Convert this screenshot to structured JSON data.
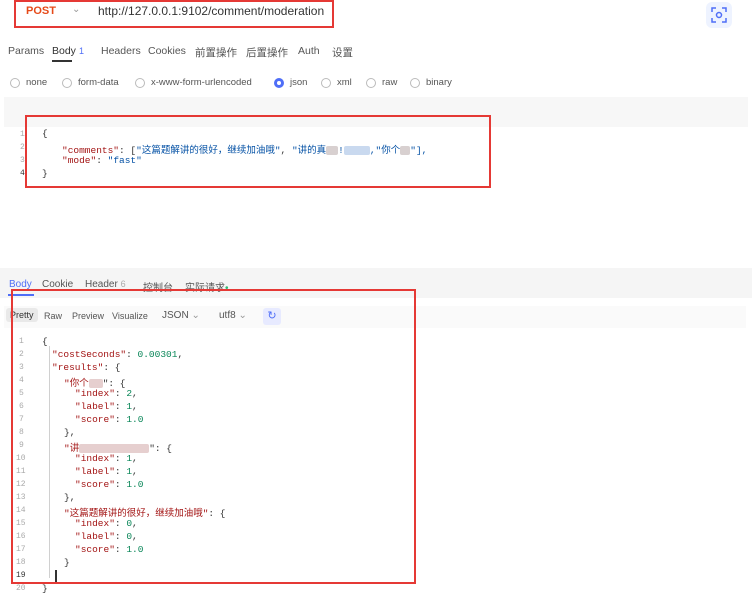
{
  "request": {
    "method": "POST",
    "url": "http://127.0.0.1:9102/comment/moderation"
  },
  "icons": {
    "scan": "scan-icon",
    "chevron": "chevron-down-icon",
    "wrap": "wrap-icon"
  },
  "colors": {
    "accent": "#4f6ef7",
    "method": "#e64a19",
    "highlight_border": "#e53935"
  },
  "request_tabs": [
    {
      "label": "Params"
    },
    {
      "label": "Body",
      "badge": "1"
    },
    {
      "label": "Headers"
    },
    {
      "label": "Cookies"
    },
    {
      "label": "前置操作"
    },
    {
      "label": "后置操作"
    },
    {
      "label": "Auth"
    },
    {
      "label": "设置"
    }
  ],
  "body_types": {
    "options": [
      "none",
      "form-data",
      "x-www-form-urlencoded",
      "json",
      "xml",
      "raw",
      "binary"
    ],
    "selected": "json"
  },
  "request_editor": {
    "line_numbers": [
      "1",
      "2",
      "3",
      "4"
    ],
    "line1": "{",
    "line2_key": "\"comments\"",
    "line2_colon": ": [",
    "line2_str1": "\"这篇题解讲的很好，继续加油哦\"",
    "line2_sep": ", ",
    "line2_str2": "\"讲的真",
    "line2_str2b": "!",
    "line2_str3": ",\"你个",
    "line2_tail": "\"],",
    "line3_key": "\"mode\"",
    "line3_colon": ": ",
    "line3_val": "\"fast\"",
    "line4": "}"
  },
  "response_tabs": {
    "body": "Body",
    "cookie": "Cookie",
    "header": "Header",
    "header_badge": "6",
    "console": "控制台",
    "actual_request": "实际请求",
    "actual_dot": "•"
  },
  "format_bar": {
    "pretty": "Pretty",
    "raw": "Raw",
    "preview": "Preview",
    "visualize": "Visualize",
    "format": "JSON",
    "encoding": "utf8"
  },
  "response_editor": {
    "line_numbers": [
      "1",
      "2",
      "3",
      "4",
      "5",
      "6",
      "7",
      "8",
      "9",
      "10",
      "11",
      "12",
      "13",
      "14",
      "15",
      "16",
      "17",
      "18",
      "19",
      "20"
    ],
    "l1": "{",
    "l2_key": "\"costSeconds\"",
    "l2_val": "0.00301",
    "l3_key": "\"results\"",
    "l3_rest": ": {",
    "l4_key": "\"你个",
    "l4_rest": "\": {",
    "index_key": "\"index\"",
    "label_key": "\"label\"",
    "score_key": "\"score\"",
    "v_index1": "2",
    "v_label1": "1",
    "v_score1": "1.0",
    "close_comma": "},",
    "l9_key": "\"讲",
    "l9_rest": "\": {",
    "v_index2": "1",
    "v_label2": "1",
    "v_score2": "1.0",
    "l14_key": "\"这篇题解讲的很好，继续加油哦\"",
    "l14_rest": ": {",
    "v_index3": "0",
    "v_label3": "0",
    "v_score3": "1.0",
    "close": "}",
    "l20": "}"
  }
}
